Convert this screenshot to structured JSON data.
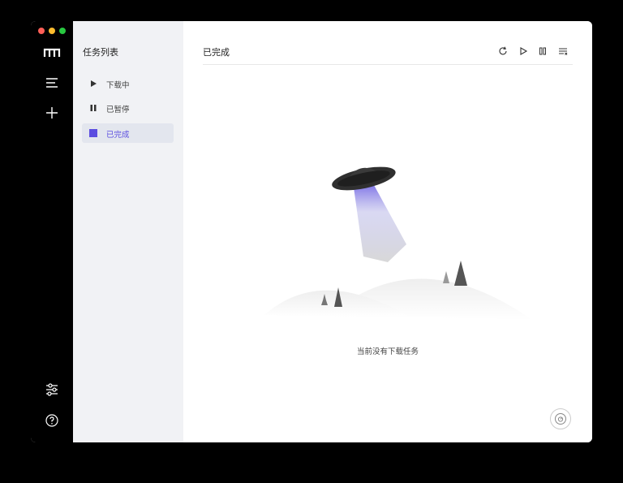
{
  "sidebar": {
    "title": "任务列表",
    "items": [
      {
        "label": "下载中",
        "icon": "play-icon",
        "active": false
      },
      {
        "label": "已暂停",
        "icon": "pause-icon",
        "active": false
      },
      {
        "label": "已完成",
        "icon": "stop-square-icon",
        "active": true
      }
    ]
  },
  "main": {
    "title": "已完成",
    "empty_text": "当前没有下载任务",
    "toolbar": [
      "refresh-icon",
      "play-icon",
      "pause-icon",
      "filter-list-icon"
    ]
  },
  "rail": {
    "icons": [
      "app-logo-icon",
      "menu-icon",
      "add-icon",
      "settings-sliders-icon",
      "help-icon"
    ]
  },
  "colors": {
    "accent": "#5b4de0",
    "rail_bg": "#000000",
    "sidebar_bg": "#f1f2f5",
    "traffic_red": "#ff5f57",
    "traffic_yellow": "#febc2e",
    "traffic_green": "#28c840"
  }
}
